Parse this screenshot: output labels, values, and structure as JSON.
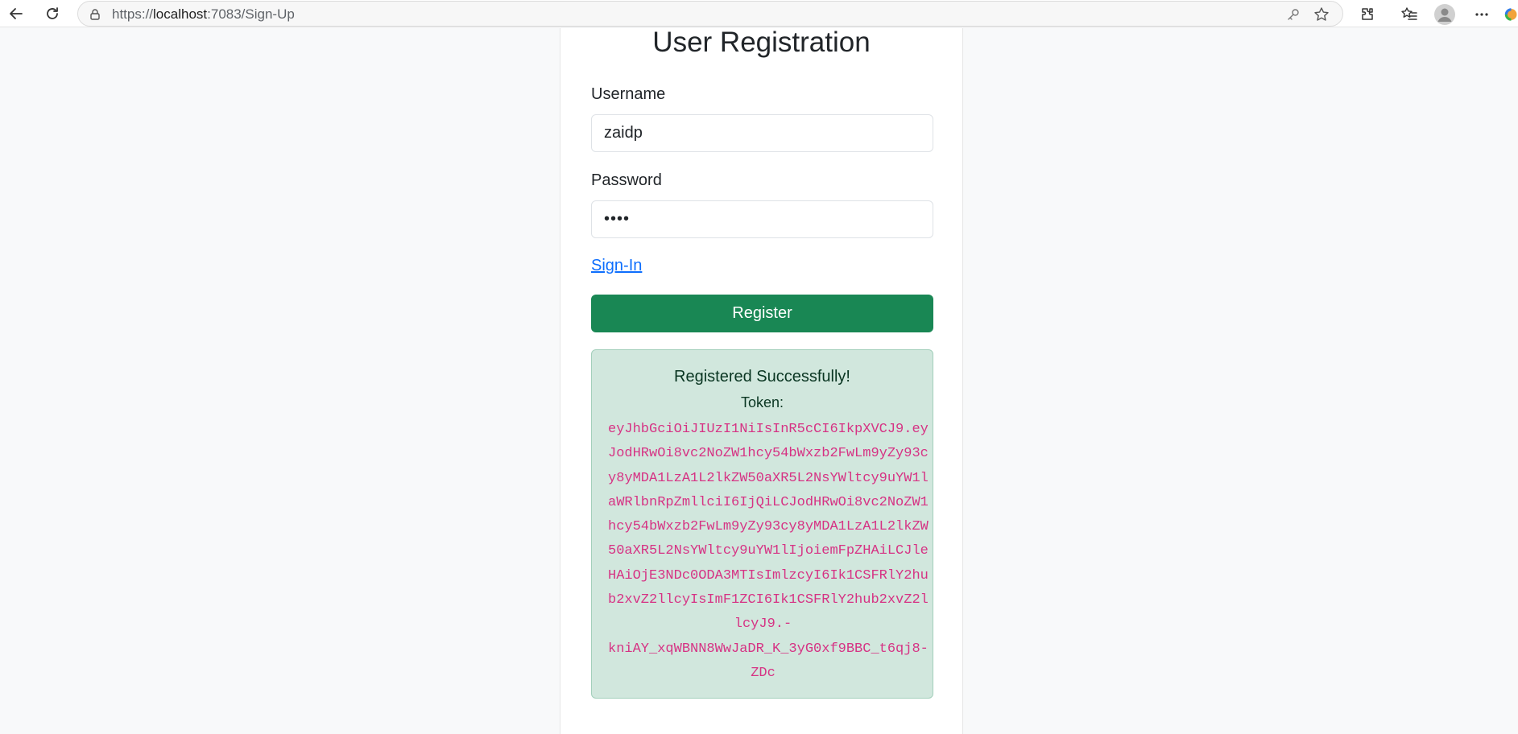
{
  "browser": {
    "url_prefix": "https://",
    "url_host": "localhost",
    "url_rest": ":7083/Sign-Up"
  },
  "form": {
    "title": "User Registration",
    "username_label": "Username",
    "username_value": "zaidp",
    "password_label": "Password",
    "password_value": "••••",
    "signin_link": "Sign-In",
    "register_button": "Register"
  },
  "alert": {
    "message": "Registered Successfully!",
    "token_label": "Token:",
    "token_lines": [
      "eyJhbGciOiJIUzI1NiIsInR5cCI6IkpXVCJ9.ey",
      "JodHRwOi8vc2NoZW1hcy54bWxzb2FwLm9yZy93c",
      "y8yMDA1LzA1L2lkZW50aXR5L2NsYWltcy9uYW1l",
      "aWRlbnRpZmllciI6IjQiLCJodHRwOi8vc2NoZW1",
      "hcy54bWxzb2FwLm9yZy93cy8yMDA1LzA1L2lkZW",
      "50aXR5L2NsYWltcy9uYW1lIjoiemFpZHAiLCJle",
      "HAiOjE3NDc0ODA3MTIsImlzcyI6Ik1CSFRlY2hu",
      "b2xvZ2llcyIsImF1ZCI6Ik1CSFRlY2hub2xvZ2l",
      "lcyJ9.-",
      "kniAY_xqWBNN8WwJaDR_K_3yG0xf9BBC_t6qj8-",
      "ZDc"
    ]
  },
  "colors": {
    "register_button": "#198754",
    "alert_bg": "#d1e7dd",
    "token_text": "#d63384",
    "link": "#0d6efd"
  }
}
